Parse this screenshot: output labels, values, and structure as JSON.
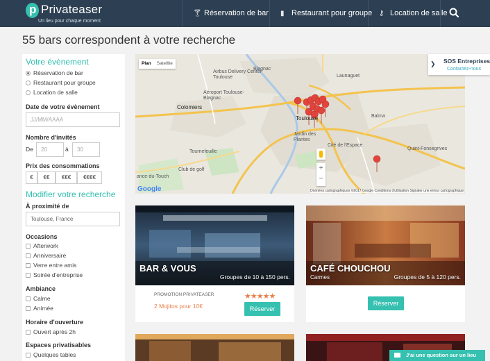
{
  "header": {
    "logo": "Privateaser",
    "tagline": "Un lieu pour chaque moment",
    "nav": [
      "Réservation de bar",
      "Restaurant pour groupe",
      "Location de salle"
    ]
  },
  "page_title": "55 bars correspondent à votre recherche",
  "sidebar": {
    "event_title": "Votre évènement",
    "event_options": [
      "Réservation de bar",
      "Restaurant pour groupe",
      "Location de salle"
    ],
    "date_label": "Date de votre évènement",
    "date_placeholder": "JJ/MM/AAAA",
    "guests_label": "Nombre d'invités",
    "guests_from": "De",
    "guests_min": "20",
    "guests_to": "à",
    "guests_max": "30",
    "price_label": "Prix des consommations",
    "price_options": [
      "€",
      "€€",
      "€€€",
      "€€€€"
    ],
    "modify_title": "Modifier votre recherche",
    "proximity_label": "À proximité de",
    "proximity_value": "Toulouse, France",
    "occasions_label": "Occasions",
    "occasions": [
      "Afterwork",
      "Anniversaire",
      "Verre entre amis",
      "Soirée d'entreprise"
    ],
    "ambiance_label": "Ambiance",
    "ambiance": [
      "Calme",
      "Animée"
    ],
    "hours_label": "Horaire d'ouverture",
    "hours": [
      "Ouvert après 2h"
    ],
    "spaces_label": "Espaces privatisables",
    "spaces": [
      "Quelques tables"
    ]
  },
  "map": {
    "tabs": [
      "Plan",
      "Satellite"
    ],
    "labels": [
      "Blagnac",
      "Airbus Delivery Center Toulouse",
      "Aéroport Toulouse-Blagnac",
      "Colomiers",
      "Toulouse",
      "Jardin des Plantes",
      "Balma",
      "Cité de l'Espace",
      "Tournefeuille",
      "Club de golf",
      "Quint-Fonsegrives",
      "ance-du-Touch",
      "Launaguet"
    ],
    "google": "Google",
    "footer": "Données cartographiques ©2017 Google   Conditions d'utilisation   Signaler une erreur cartographique",
    "zoom_in": "+",
    "zoom_out": "−"
  },
  "sos": {
    "title": "SOS Entreprises",
    "link": "Contactez-nous"
  },
  "cards": [
    {
      "name": "BAR & VOUS",
      "area": "",
      "groups": "Groupes de 10 à 150 pers.",
      "promo_label": "PROMOTION PRIVATEASER",
      "promo_value": "2 Mojitos pour 10€",
      "rating": 5,
      "reserve": "Réserver"
    },
    {
      "name": "CAFÉ CHOUCHOU",
      "area": "Carmes",
      "groups": "Groupes de 5 à 120 pers.",
      "promo_label": "",
      "promo_value": "",
      "reserve": "Réserver"
    }
  ],
  "chat": "J'ai une question sur un lieu"
}
